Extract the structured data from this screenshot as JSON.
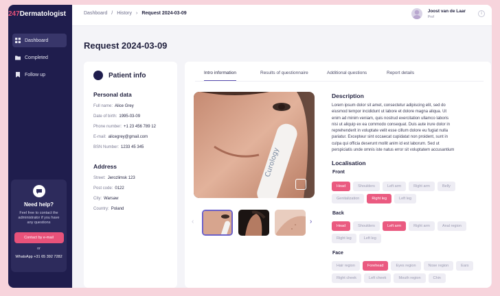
{
  "logo": {
    "prefix": "247",
    "name": "Dermatologist"
  },
  "nav": [
    {
      "label": "Dashboard",
      "icon": "grid-icon",
      "active": true
    },
    {
      "label": "Completed",
      "icon": "folder-icon",
      "active": false
    },
    {
      "label": "Follow up",
      "icon": "bookmark-icon",
      "active": false
    }
  ],
  "help": {
    "title": "Need help?",
    "text": "Feel free to contact the administrator if you have any questions",
    "button": "Contact by e-mail",
    "or": "or",
    "whatsapp": "WhatsApp +31 65 392 7282"
  },
  "breadcrumbs": [
    "Dashboard",
    "History",
    "Request 2024-03-09"
  ],
  "user": {
    "name": "Joost van de Laar",
    "role": "Prof"
  },
  "page_title": "Request  2024-03-09",
  "patient": {
    "title": "Patient info",
    "personal_title": "Personal data",
    "personal": [
      {
        "k": "Full name:",
        "v": "Alice Grey"
      },
      {
        "k": "Date of birth:",
        "v": "1995-03-09"
      },
      {
        "k": "Phone number:",
        "v": "+1 23 456 789 12"
      },
      {
        "k": "E-mail:",
        "v": "alicegrey@gmail.com"
      },
      {
        "k": "BSN Number:",
        "v": "1233 45 345"
      }
    ],
    "address_title": "Address",
    "address": [
      {
        "k": "Street:",
        "v": "Jerozlimsk 123"
      },
      {
        "k": "Post code:",
        "v": "0122"
      },
      {
        "k": "City:",
        "v": "Warsaw"
      },
      {
        "k": "Country:",
        "v": "Poland"
      }
    ]
  },
  "tabs": [
    {
      "label": "Intro information",
      "active": true
    },
    {
      "label": "Results of questionnaire",
      "active": false
    },
    {
      "label": "Additional questions",
      "active": false
    },
    {
      "label": "Report details",
      "active": false
    }
  ],
  "photo": {
    "brand": "Curology"
  },
  "description": {
    "title": "Description",
    "text": "Lorem ipsum dolor sit amet, consectetur adipiscing elit, sed do eiusmod tempor incididunt ut labore et dolore magna aliqua. Ut enim ad minim veniam, quis nostrud exercitation ullamco laboris nisi ut aliquip ex ea commodo consequat. Duis aute irure dolor in reprehenderit in voluptate velit esse cillum dolore eu fugiat nulla pariatur. Excepteur sint occaecat cupidatat non proident, sunt in culpa qui officia deserunt mollit anim id est laborum. Sed ut perspiciatis unde omnis iste natus error sit voluptatem accusantium doloremque laudantium, totam rem aperiam, eaque ipsa quae ab illo inventore veritatis et quasi architecto beatae vitae dicta sunt explicabo. Nemo enim ipsam voluptatem quia voluptas sit aspernatur aut odit aut fugit, sed quia consequuntur magni dolores eos qui ratione voluptatem sequi nesciunt. Neque porro quisquam est, qui dolorem ipsum quia dolor sit amet, con..."
  },
  "localisation": {
    "title": "Localisation",
    "groups": [
      {
        "name": "Front",
        "chips": [
          {
            "label": "Head",
            "on": true
          },
          {
            "label": "Shoulders",
            "on": false
          },
          {
            "label": "Left arm",
            "on": false
          },
          {
            "label": "Right arm",
            "on": false
          },
          {
            "label": "Belly",
            "on": false
          },
          {
            "label": "Genitalization",
            "on": false
          },
          {
            "label": "Right leg",
            "on": true
          },
          {
            "label": "Left leg",
            "on": false
          }
        ]
      },
      {
        "name": "Back",
        "chips": [
          {
            "label": "Head",
            "on": true
          },
          {
            "label": "Shoulders",
            "on": false
          },
          {
            "label": "Left arm",
            "on": true
          },
          {
            "label": "Right arm",
            "on": false
          },
          {
            "label": "Anal region",
            "on": false
          },
          {
            "label": "Right leg",
            "on": false
          },
          {
            "label": "Left leg",
            "on": false
          }
        ]
      },
      {
        "name": "Face",
        "chips": [
          {
            "label": "Hair region",
            "on": false
          },
          {
            "label": "Forehead",
            "on": true
          },
          {
            "label": "Eyes region",
            "on": false
          },
          {
            "label": "Nose region",
            "on": false
          },
          {
            "label": "Ears",
            "on": false
          },
          {
            "label": "Right cheek",
            "on": false
          },
          {
            "label": "Left cheek",
            "on": false
          },
          {
            "label": "Mouth region",
            "on": false
          },
          {
            "label": "Chin",
            "on": false
          }
        ]
      }
    ]
  }
}
